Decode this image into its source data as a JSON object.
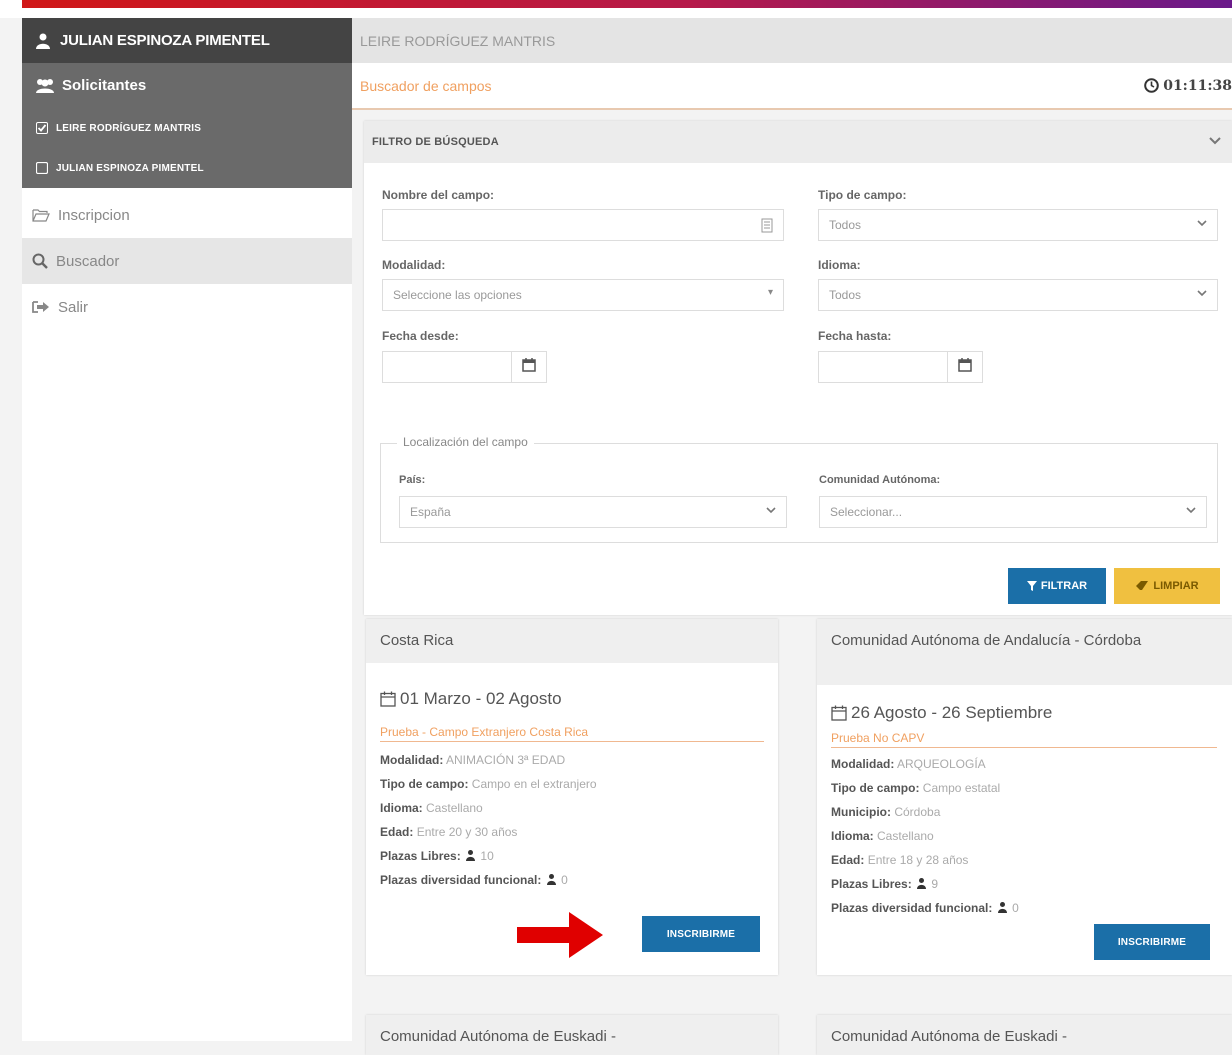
{
  "sidebar": {
    "user_name": "JULIAN ESPINOZA PIMENTEL",
    "section_label": "Solicitantes",
    "applicants": [
      {
        "label": "LEIRE RODRÍGUEZ MANTRIS",
        "checked": true
      },
      {
        "label": "JULIAN ESPINOZA PIMENTEL",
        "checked": false
      }
    ],
    "nav": [
      {
        "label": "Inscripcion",
        "icon": "folder-open-icon",
        "active": false
      },
      {
        "label": "Buscador",
        "icon": "search-icon",
        "active": true
      },
      {
        "label": "Salir",
        "icon": "sign-out-icon",
        "active": false
      }
    ]
  },
  "header": {
    "selected_user": "LEIRE RODRÍGUEZ MANTRIS",
    "breadcrumb": "Buscador de campos",
    "timer": "01:11:38"
  },
  "filter": {
    "title": "FILTRO DE BÚSQUEDA",
    "name_label": "Nombre del campo:",
    "name_value": "",
    "type_label": "Tipo de campo:",
    "type_value": "Todos",
    "mode_label": "Modalidad:",
    "mode_placeholder": "Seleccione las opciones",
    "lang_label": "Idioma:",
    "lang_value": "Todos",
    "from_label": "Fecha desde:",
    "to_label": "Fecha hasta:",
    "location_legend": "Localización del campo",
    "country_label": "País:",
    "country_value": "España",
    "region_label": "Comunidad Autónoma:",
    "region_value": "Seleccionar...",
    "filter_btn": "FILTRAR",
    "clear_btn": "LIMPIAR"
  },
  "cards": [
    {
      "title": "Costa Rica",
      "dates": "01 Marzo - 02 Agosto",
      "subtitle": "Prueba - Campo Extranjero Costa Rica",
      "modalidad": "ANIMACIÓN 3ª EDAD",
      "tipo": "Campo en el extranjero",
      "idioma": "Castellano",
      "edad": "Entre 20 y 30 años",
      "plazas": "10",
      "diversidad": "0",
      "button": "INSCRIBIRME"
    },
    {
      "title": "Comunidad Autónoma de Andalucía - Córdoba",
      "dates": "26 Agosto - 26 Septiembre",
      "subtitle": "Prueba No CAPV",
      "modalidad": "ARQUEOLOGÍA",
      "tipo": "Campo estatal",
      "municipio": "Córdoba",
      "idioma": "Castellano",
      "edad": "Entre 18 y 28 años",
      "plazas": "9",
      "diversidad": "0",
      "button": "INSCRIBIRME"
    },
    {
      "title": "Comunidad Autónoma de Euskadi -"
    },
    {
      "title": "Comunidad Autónoma de Euskadi -"
    }
  ],
  "labels": {
    "modalidad": "Modalidad:",
    "tipo": "Tipo de campo:",
    "municipio": "Municipio:",
    "idioma": "Idioma:",
    "edad": "Edad:",
    "plazas": "Plazas Libres:",
    "diversidad": "Plazas diversidad funcional:"
  },
  "colors": {
    "sidebar_dark": "#444444",
    "sidebar_section": "#6a6a6a",
    "primary_button": "#1b6fa8",
    "clear_button": "#f0c040",
    "accent_orange": "#f0a060",
    "arrow_red": "#e00000"
  }
}
